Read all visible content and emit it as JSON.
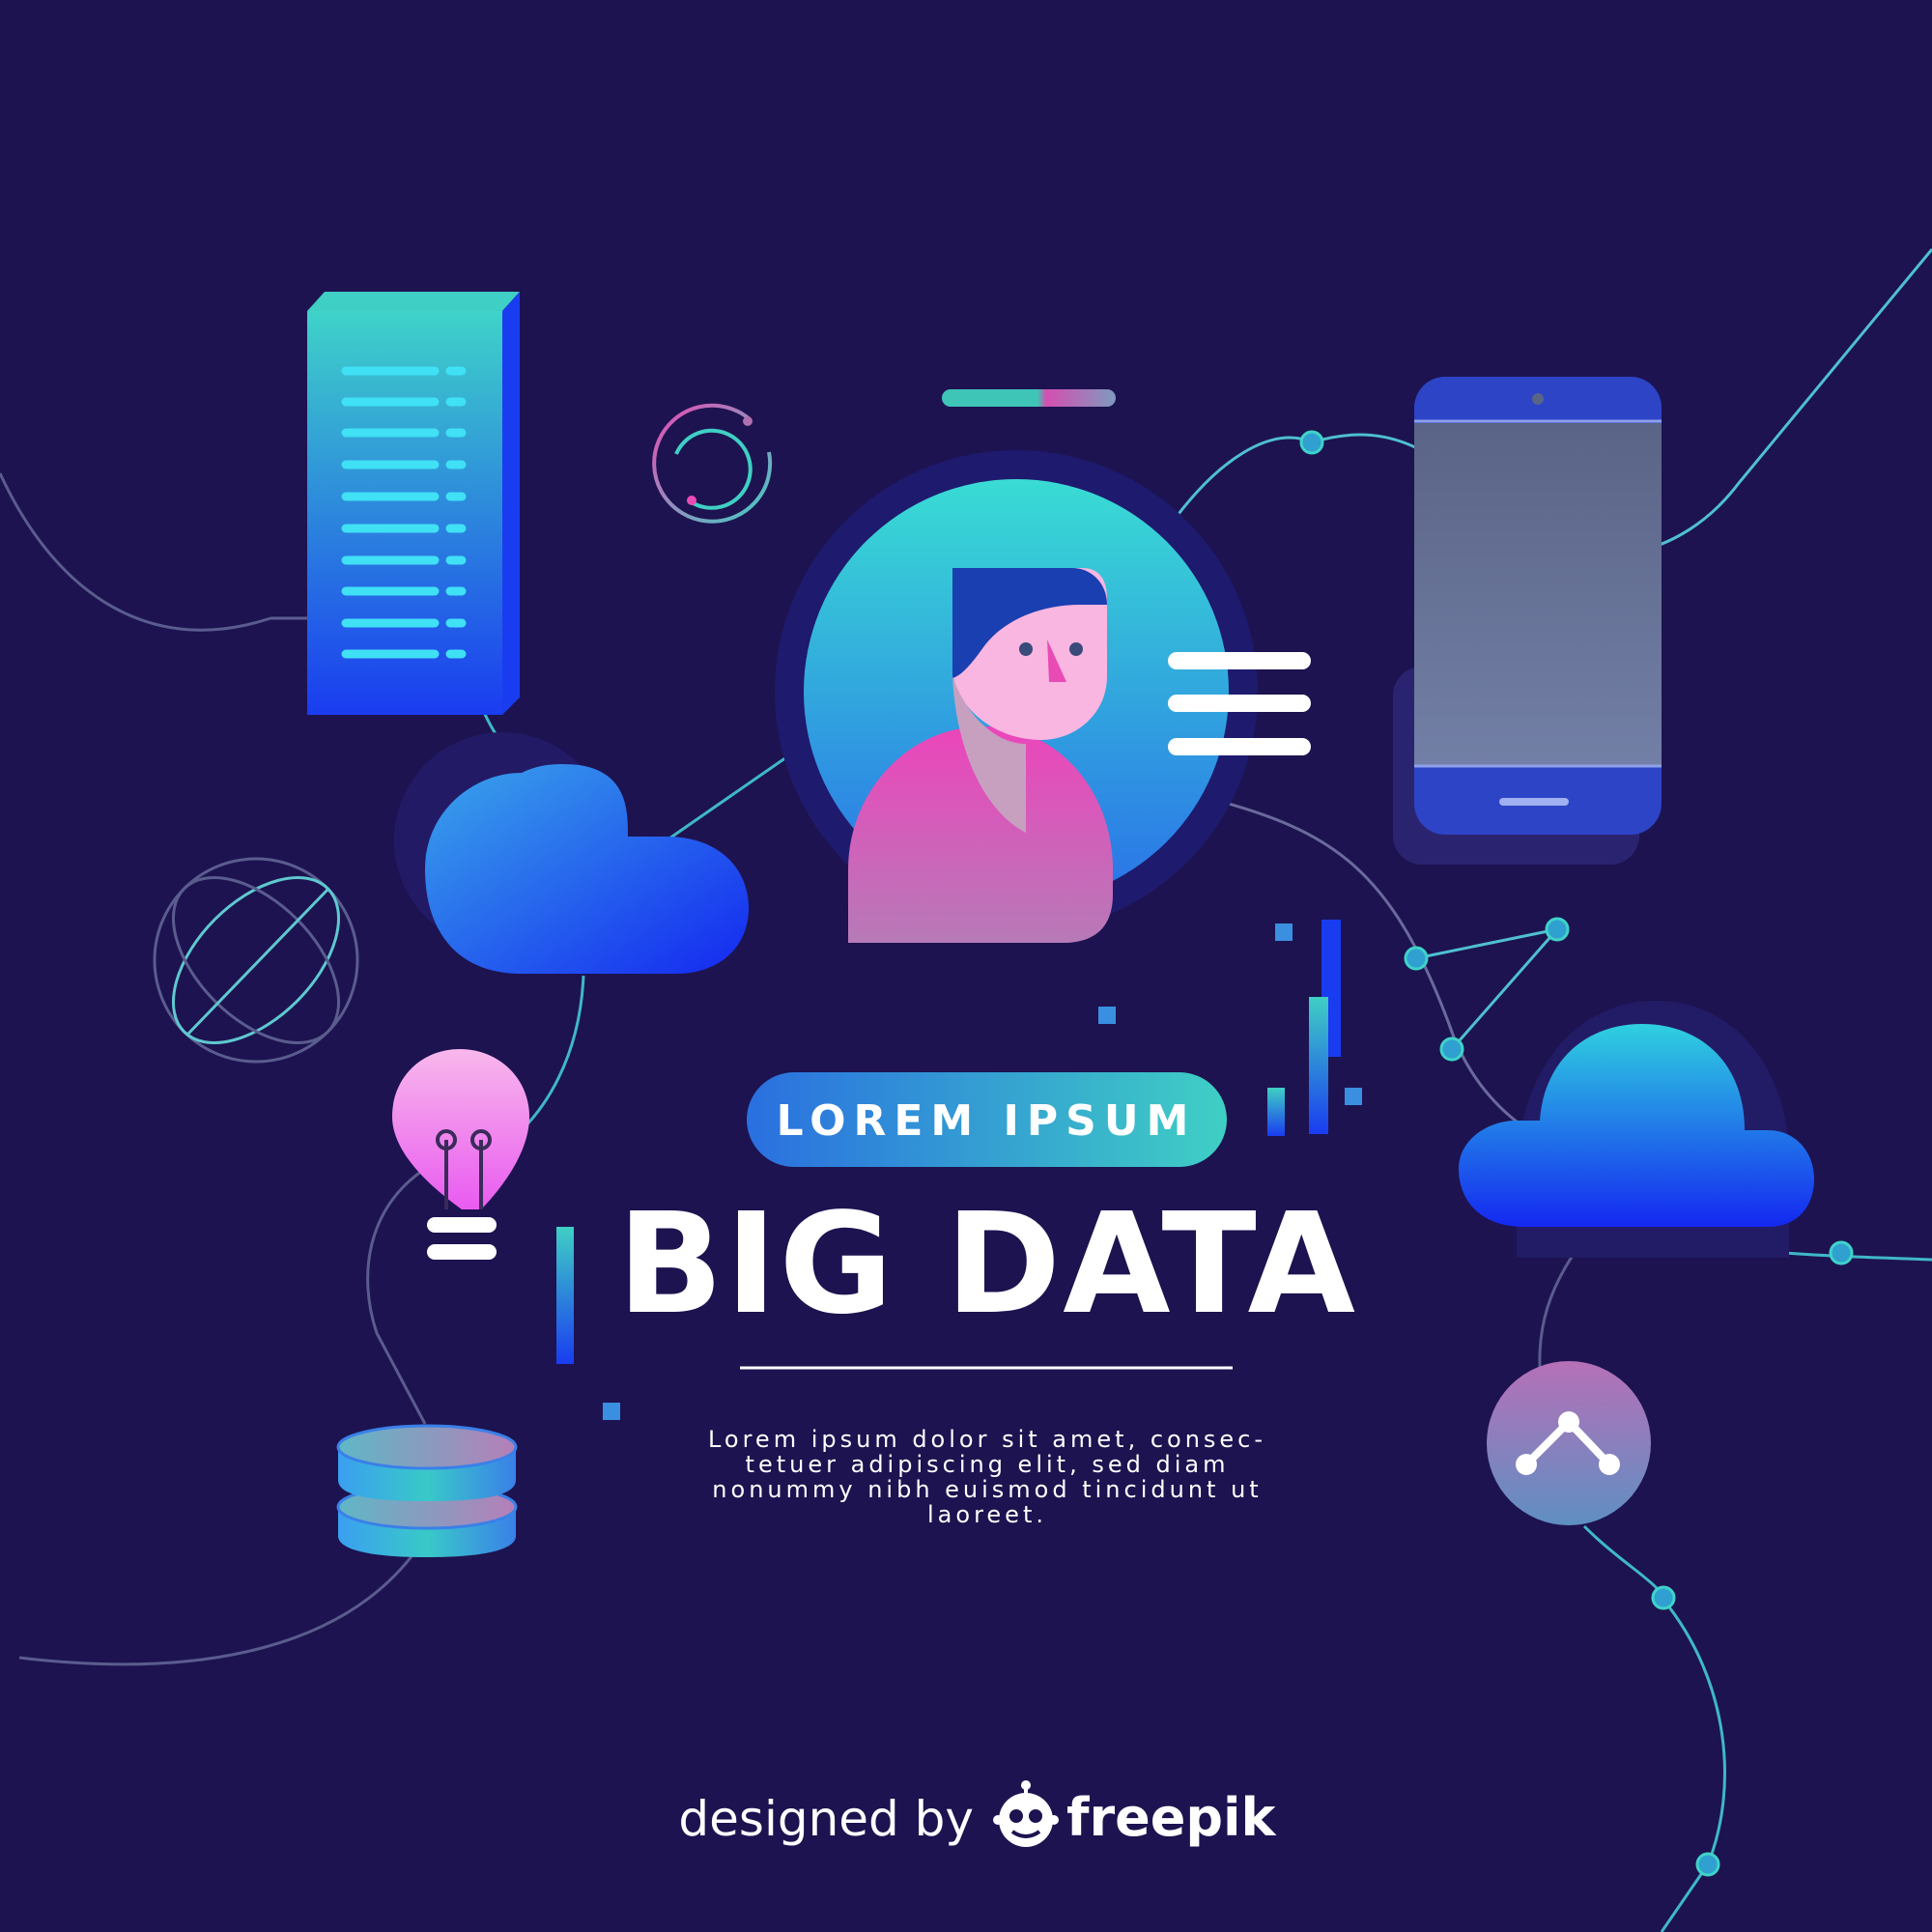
{
  "pill_label": "LOREM IPSUM",
  "title": "BIG DATA",
  "body_lines": [
    "Lorem ipsum dolor sit amet, consec-",
    "tetuer adipiscing elit, sed diam",
    "nonummy nibh euismod tincidunt ut",
    "laoreet."
  ],
  "credit_prefix": "designed by",
  "credit_brand": "freepik",
  "colors": {
    "background": "#1d1350",
    "teal": "#3fd3c9",
    "blue": "#1a3cf0",
    "pink": "#e94bb5",
    "white": "#ffffff"
  },
  "icons": [
    "server-rack-icon",
    "cloud-icon",
    "globe-icon",
    "lightbulb-icon",
    "database-icon",
    "smartphone-icon",
    "user-avatar-icon",
    "menu-lines-icon",
    "share-node-icon",
    "refresh-circle-icon",
    "freepik-logo-icon"
  ]
}
